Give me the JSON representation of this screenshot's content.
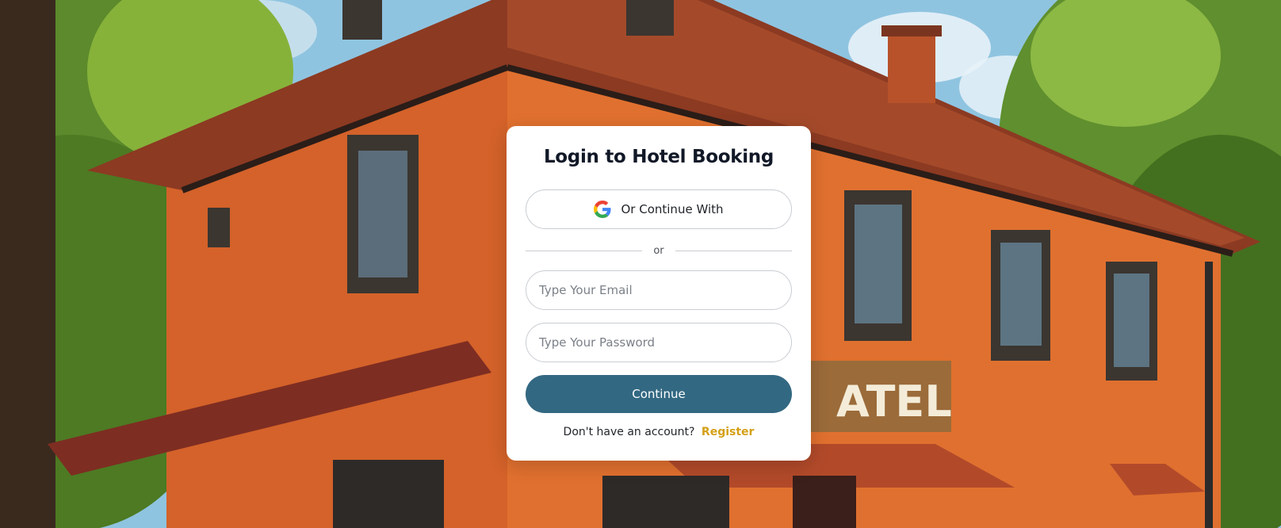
{
  "login": {
    "title": "Login to Hotel Booking",
    "google_button_label": "Or Continue With",
    "divider_text": "or",
    "email_placeholder": "Type Your Email",
    "password_placeholder": "Type Your Password",
    "continue_label": "Continue",
    "register_prompt": "Don't have an account?",
    "register_link": "Register"
  },
  "background": {
    "sign_text": "ATEL"
  },
  "colors": {
    "primary_button": "#336882",
    "register_link": "#d4a017",
    "building": "#d4622a",
    "roof": "#8c3a22"
  },
  "icons": {
    "google": "google-icon"
  }
}
